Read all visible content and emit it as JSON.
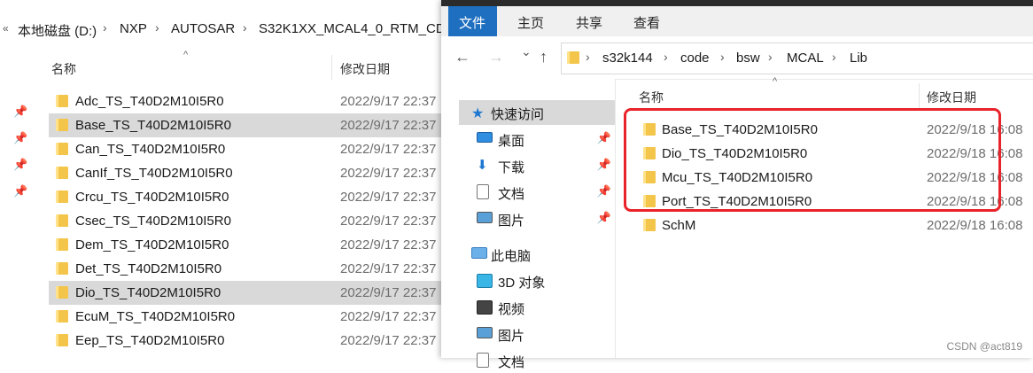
{
  "left_window": {
    "breadcrumb": [
      "本地磁盘 (D:)",
      "NXP",
      "AUTOSAR",
      "S32K1XX_MCAL4_0_RTM_CD"
    ],
    "breadcrumb_prefix": "«",
    "sort_caret": "^",
    "columns": {
      "name": "名称",
      "date": "修改日期"
    },
    "rows": [
      {
        "name": "Adc_TS_T40D2M10I5R0",
        "date": "2022/9/17 22:37",
        "selected": false
      },
      {
        "name": "Base_TS_T40D2M10I5R0",
        "date": "2022/9/17 22:37",
        "selected": true
      },
      {
        "name": "Can_TS_T40D2M10I5R0",
        "date": "2022/9/17 22:37",
        "selected": false
      },
      {
        "name": "CanIf_TS_T40D2M10I5R0",
        "date": "2022/9/17 22:37",
        "selected": false
      },
      {
        "name": "Crcu_TS_T40D2M10I5R0",
        "date": "2022/9/17 22:37",
        "selected": false
      },
      {
        "name": "Csec_TS_T40D2M10I5R0",
        "date": "2022/9/17 22:37",
        "selected": false
      },
      {
        "name": "Dem_TS_T40D2M10I5R0",
        "date": "2022/9/17 22:37",
        "selected": false
      },
      {
        "name": "Det_TS_T40D2M10I5R0",
        "date": "2022/9/17 22:37",
        "selected": false
      },
      {
        "name": "Dio_TS_T40D2M10I5R0",
        "date": "2022/9/17 22:37",
        "selected": true
      },
      {
        "name": "EcuM_TS_T40D2M10I5R0",
        "date": "2022/9/17 22:37",
        "selected": false
      },
      {
        "name": "Eep_TS_T40D2M10I5R0",
        "date": "2022/9/17 22:37",
        "selected": false
      }
    ]
  },
  "right_window": {
    "ribbon_tabs": [
      "文件",
      "主页",
      "共享",
      "查看"
    ],
    "nav_icons": {
      "back": "←",
      "forward": "→",
      "recent": "⌄",
      "up": "↑"
    },
    "address": [
      "s32k144",
      "code",
      "bsw",
      "MCAL",
      "Lib"
    ],
    "columns": {
      "name": "名称",
      "date": "修改日期"
    },
    "sort_caret": "^",
    "nav_pane": {
      "quick_access": "快速访问",
      "items": [
        {
          "label": "桌面",
          "icon": "desktop-icon"
        },
        {
          "label": "下载",
          "icon": "download-icon"
        },
        {
          "label": "文档",
          "icon": "document-icon"
        },
        {
          "label": "图片",
          "icon": "picture-icon"
        }
      ],
      "this_pc": "此电脑",
      "pc_items": [
        {
          "label": "3D 对象",
          "icon": "3d-objects-icon"
        },
        {
          "label": "视频",
          "icon": "video-icon"
        },
        {
          "label": "图片",
          "icon": "picture-icon"
        },
        {
          "label": "文档",
          "icon": "document-icon"
        }
      ]
    },
    "rows": [
      {
        "name": "Base_TS_T40D2M10I5R0",
        "date": "2022/9/18 16:08"
      },
      {
        "name": "Dio_TS_T40D2M10I5R0",
        "date": "2022/9/18 16:08"
      },
      {
        "name": "Mcu_TS_T40D2M10I5R0",
        "date": "2022/9/18 16:08"
      },
      {
        "name": "Port_TS_T40D2M10I5R0",
        "date": "2022/9/18 16:08"
      },
      {
        "name": "SchM",
        "date": "2022/9/18 16:08"
      }
    ]
  },
  "watermark": "CSDN @act819",
  "colors": {
    "highlight_box": "#e8232a",
    "file_tab": "#1f6fc0",
    "selection": "#d9d9d9"
  }
}
